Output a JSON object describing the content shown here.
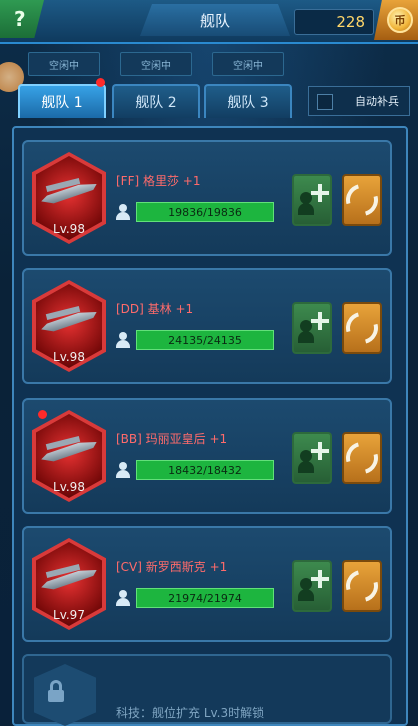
{
  "header": {
    "help": "?",
    "title": "舰队",
    "coins": "228",
    "coin_badge": "币"
  },
  "slots_status": [
    "空闲中",
    "空闲中",
    "空闲中"
  ],
  "tabs": [
    {
      "label": "舰队 1"
    },
    {
      "label": "舰队 2"
    },
    {
      "label": "舰队 3"
    }
  ],
  "auto_replenish": "自动补兵",
  "ships": [
    {
      "name": "[FF] 格里莎 +1",
      "level": "Lv.98",
      "hp": "19836/19836"
    },
    {
      "name": "[DD] 基林 +1",
      "level": "Lv.98",
      "hp": "24135/24135"
    },
    {
      "name": "[BB] 玛丽亚皇后 +1",
      "level": "Lv.98",
      "hp": "18432/18432"
    },
    {
      "name": "[CV] 新罗西斯克 +1",
      "level": "Lv.97",
      "hp": "21974/21974"
    }
  ],
  "locked_slot": {
    "text": "科技：舰位扩充 Lv.3时解锁"
  },
  "colors": {
    "accent": "#37a2e6",
    "hp_bar": "#1db53f",
    "name_red": "#ff6b6b",
    "swap": "#e8a33a"
  }
}
